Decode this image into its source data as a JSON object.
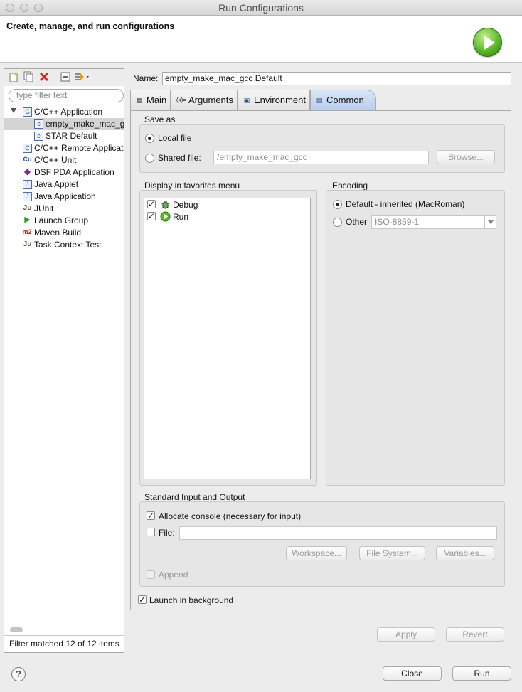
{
  "window": {
    "title": "Run Configurations"
  },
  "header": {
    "title": "Create, manage, and run configurations",
    "icon": "run-icon"
  },
  "left": {
    "toolbar": [
      "new-configuration-icon",
      "duplicate-icon",
      "delete-icon",
      "collapse-all-icon",
      "filter-icon"
    ],
    "filter_placeholder": "type filter text",
    "tree": [
      {
        "label": "C/C++ Application",
        "icon": "c-app-icon",
        "icon_text": "C"
      },
      {
        "label": "empty_make_mac_gcc",
        "icon": "c-config-icon",
        "icon_text": "c"
      },
      {
        "label": "STAR Default",
        "icon": "c-config-icon",
        "icon_text": "c"
      },
      {
        "label": "C/C++ Remote Applicati",
        "icon": "c-remote-icon",
        "icon_text": "C"
      },
      {
        "label": "C/C++ Unit",
        "icon": "c-unit-icon",
        "icon_text": "Cu"
      },
      {
        "label": "DSF PDA Application",
        "icon": "dsf-icon",
        "icon_text": "◆"
      },
      {
        "label": "Java Applet",
        "icon": "java-applet-icon",
        "icon_text": "J"
      },
      {
        "label": "Java Application",
        "icon": "java-app-icon",
        "icon_text": "J"
      },
      {
        "label": "JUnit",
        "icon": "junit-icon",
        "icon_text": "Ju"
      },
      {
        "label": "Launch Group",
        "icon": "launch-group-icon",
        "icon_text": "▶"
      },
      {
        "label": "Maven Build",
        "icon": "maven-icon",
        "icon_text": "m2"
      },
      {
        "label": "Task Context Test",
        "icon": "task-context-icon",
        "icon_text": "Ju"
      }
    ],
    "status": "Filter matched 12 of 12 items"
  },
  "name_label": "Name:",
  "name_value": "empty_make_mac_gcc Default",
  "tabs": [
    {
      "label": "Main",
      "icon_text": "▤"
    },
    {
      "label": "Arguments",
      "icon_text": "(x)="
    },
    {
      "label": "Environment",
      "icon_text": "▣"
    },
    {
      "label": "Common",
      "icon_text": "▤"
    }
  ],
  "active_tab": "Common",
  "save_as": {
    "title": "Save as",
    "local_file": "Local file",
    "shared_file": "Shared file:",
    "shared_path": "/empty_make_mac_gcc",
    "browse": "Browse..."
  },
  "favorites": {
    "title": "Display in favorites menu",
    "items": [
      {
        "label": "Debug",
        "checked": true
      },
      {
        "label": "Run",
        "checked": true
      }
    ]
  },
  "encoding": {
    "title": "Encoding",
    "default": "Default - inherited (MacRoman)",
    "other": "Other",
    "other_value": "ISO-8859-1"
  },
  "stdio": {
    "title": "Standard Input and Output",
    "allocate_console": "Allocate console (necessary for input)",
    "file": "File:",
    "workspace": "Workspace...",
    "file_system": "File System...",
    "variables": "Variables...",
    "append": "Append"
  },
  "launch_background": "Launch in background",
  "apply": "Apply",
  "revert": "Revert",
  "close": "Close",
  "run": "Run",
  "help": "?",
  "colors": {
    "active_tab": "#b9cdee",
    "run_green": "#5db72b",
    "delete_red": "#d22"
  }
}
